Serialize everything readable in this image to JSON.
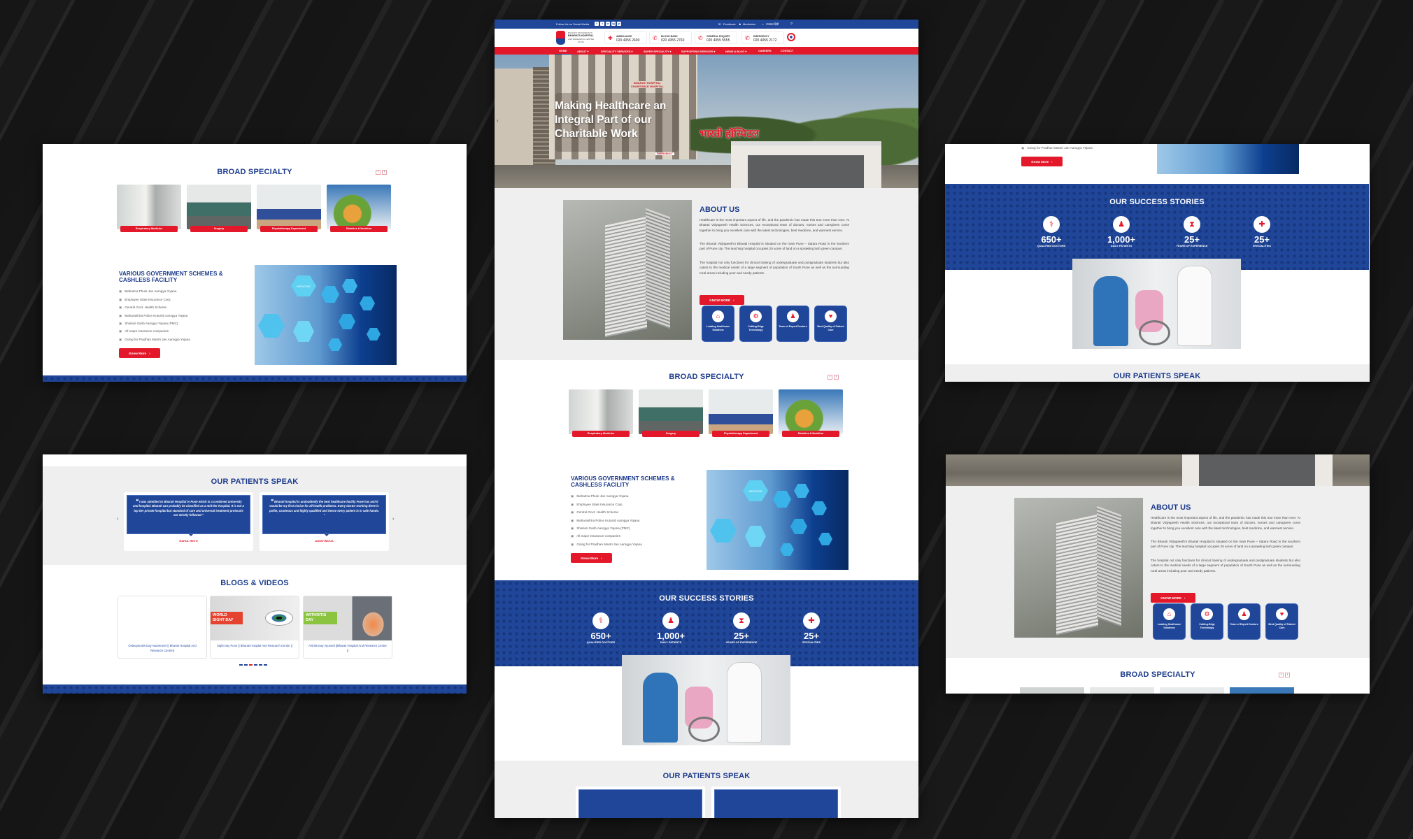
{
  "topbar": {
    "social_label": "Follow Us on Social Media",
    "social": [
      "f",
      "t",
      "in",
      "ig",
      "yt"
    ],
    "feedback": "Feedback",
    "mediclaim": "Mediclaim",
    "hindi": "उपलब्ध हिंदी"
  },
  "header": {
    "logo_line1": "BHARATI VIDYAPEETH'S",
    "logo_line2": "BHARATI HOSPITAL",
    "logo_line3": "AND RESEARCH CENTRE",
    "logo_line4": "PUNE",
    "contacts": [
      {
        "label": "AMBULANCE",
        "number": "020 4055 2400"
      },
      {
        "label": "BLOOD BANK",
        "number": "020 4055 2760"
      },
      {
        "label": "GENERAL ENQUIRY",
        "number": "020 4055 5555"
      },
      {
        "label": "EMERGENCY",
        "number": "020 4055 2172"
      }
    ]
  },
  "nav": [
    "HOME",
    "ABOUT ▾",
    "SPECIALITY SERVICES ▾",
    "SUPER SPECIALITY ▾",
    "SUPPORTING SERVICES ▾",
    "NEWS & BLOG ▾",
    "CAREERS",
    "CONTACT"
  ],
  "hero": {
    "line1": "Making Healthcare an",
    "line2": "Integral Part of our",
    "line3": "Charitable Work",
    "sign": "भारती हॉस्पिटल",
    "building_sign1": "BHARATI HOSPITAL",
    "building_sign2": "CHARITABLE HOSPITAL",
    "emergency": "EMERGENCY"
  },
  "about": {
    "title": "ABOUT US",
    "paragraphs": [
      "Healthcare is the most important aspect of life, and the pandemic has made this true more than ever. At Bharati Vidyapeeth Health Sciences, our exceptional team of doctors, nurses and caregivers come together to bring you excellent care with the latest technologies, best medicine, and warmest service.",
      "The Bharati Vidyapeeth's Bharati Hospital is situated on the main Pune – Satara Road in the southern part of Pune city. The teaching hospital occupies 25 acres of land on a sprawling lush green campus.",
      "The hospital not only functions for clinical training of undergraduate and postgraduate students but also caters to the medical needs of a large segment of population of South Pune as well as the surrounding rural areas including poor and needy patients."
    ],
    "button": "KNOW MORE",
    "features": [
      "Leading Healthcare Solutions",
      "Cutting-Edge Technology",
      "Team of Expert Doctors",
      "Best Quality of Patient Care"
    ]
  },
  "broad": {
    "title": "BROAD SPECIALTY",
    "cards": [
      "Respiratory Medicine",
      "Surgery",
      "Physiotherapy Department",
      "Dietetics & Nutrition"
    ]
  },
  "gov": {
    "title1": "VARIOUS GOVERNMENT SCHEMES &",
    "title2": "CASHLESS FACILITY",
    "items": [
      "Mahatma Phule Jan Aarogya Yojana",
      "Employee State Insurance Corp.",
      "Central Govt. Health Scheme",
      "Maharashtra Police Kutumb Aarogya Yojana",
      "Shahari Garib Aarogya Yojana (PMC)",
      "All major insurance companies",
      "Going for Pradhan Mantri Jan Aarogya Yojana"
    ],
    "button": "Know More",
    "image_text": "MEDICINE"
  },
  "success": {
    "title": "OUR SUCCESS STORIES",
    "stats": [
      {
        "value": "650+",
        "label": "QUALIFIED DOCTORS"
      },
      {
        "value": "1,000+",
        "label": "DAILY PATIENTS"
      },
      {
        "value": "25+",
        "label": "YEARS OF EXPERIENCE"
      },
      {
        "value": "25+",
        "label": "SPECIALITIES"
      }
    ]
  },
  "patients": {
    "title": "OUR PATIENTS SPEAK",
    "testimonials": [
      {
        "quote": "I was admitted to Bharati Hospital in Pune which is a combined university and hospital. Bharati can probably be classified as a mid-tier hospital. It is not a top tier private hospital but standard of care and universal treatment protocols are strictly followed.\"",
        "name": "RAHUL REVO"
      },
      {
        "quote": "Bharati hospital is undoubtedly the best healthcare facility Pune has and it would be my first choice for all health problems. Every doctor working there is polite, courteous and highly qualified and hence every patient is in safe hands. \"",
        "name": "ANONYMOUS"
      }
    ]
  },
  "blogs": {
    "title": "BLOGS & VIDEOS",
    "cards": [
      {
        "caption": "Osteoporosis Day Awareness || Bharati Hospital And Research Centre||"
      },
      {
        "caption": "Sight Day Pune || Bharati Hospital And Research Centre ||",
        "banner1": "WORLD",
        "banner2": "SIGHT DAY"
      },
      {
        "caption": "Artiritis Day Ayurved ||Bharati Hospital And Research Centre ||",
        "banner1": "ARTHRITIS",
        "banner2": "DAY"
      }
    ]
  },
  "colors": {
    "brand_blue": "#1f4699",
    "brand_red": "#e3192b",
    "section_gray": "#efefef"
  }
}
